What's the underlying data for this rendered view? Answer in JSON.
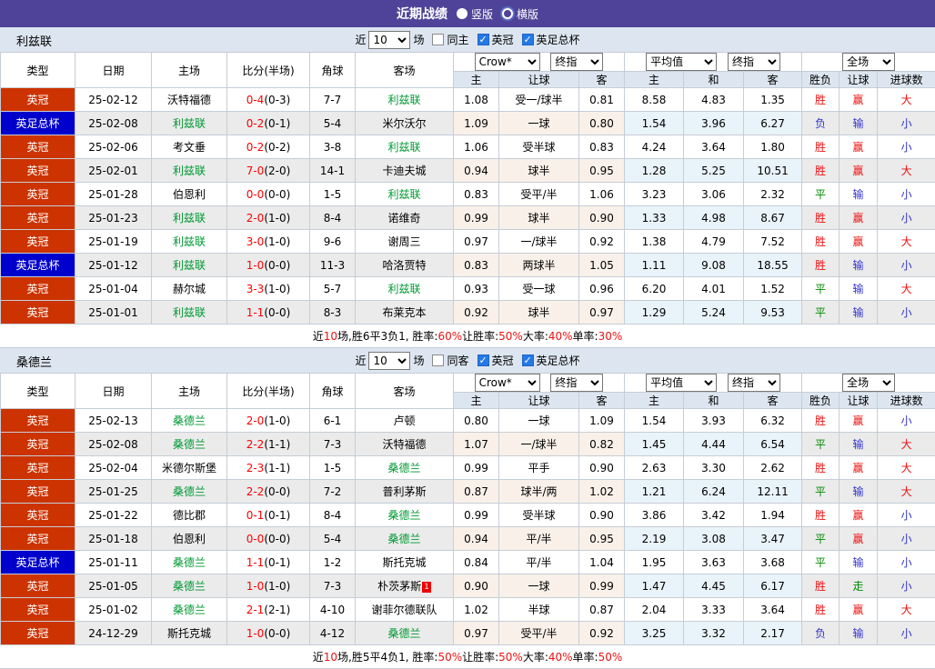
{
  "titlebar": {
    "title": "近期战绩",
    "options": [
      {
        "label": "竖版",
        "selected": true
      },
      {
        "label": "横版",
        "selected": false
      }
    ]
  },
  "header": {
    "cols": [
      "类型",
      "日期",
      "主场",
      "比分(半场)",
      "角球",
      "客场"
    ],
    "sub": [
      "主",
      "让球",
      "客",
      "主",
      "和",
      "客",
      "胜负",
      "让球",
      "进球数"
    ]
  },
  "type_colors": {
    "英冠": "#cc3300",
    "英足总杯": "#0000cc"
  },
  "colors": {
    "titlebar_bg": "#4f4399",
    "league_badge": "#cc3300",
    "cup_badge": "#0000cc",
    "focus_team_green": "#009933",
    "score_red": "#ff0000",
    "win_red": "#ee1111",
    "draw_green": "#008800",
    "lose_blue": "#3333cc",
    "header_bg": "#dde6f0",
    "handicap_col_bg": "#f9f1e9",
    "average_col_bg": "#e9f3fa",
    "alt_row_bg": "#ebebeb"
  },
  "sections": [
    {
      "team": "利兹联",
      "filter": {
        "prefix": "近",
        "count": "10",
        "suffix": "场",
        "same": "同主",
        "same_checked": false,
        "league1": "英冠",
        "league1_checked": true,
        "league2": "英足总杯",
        "league2_checked": true
      },
      "selects": {
        "odds": "Crow*",
        "odds_time": "终指",
        "avg": "平均值",
        "avg_time": "终指",
        "scope": "全场"
      },
      "rows": [
        {
          "type": "英冠",
          "date": "25-02-12",
          "home": {
            "t": "沃特福德"
          },
          "score": "0-4",
          "half": "(0-3)",
          "corners": "7-7",
          "away": {
            "t": "利兹联",
            "f": 1
          },
          "odds": [
            "1.08",
            "受一/球半",
            "0.81"
          ],
          "avg": [
            "8.58",
            "4.83",
            "1.35"
          ],
          "res": [
            [
              "胜",
              "r"
            ],
            [
              "赢",
              "r"
            ],
            [
              "大",
              "r"
            ]
          ]
        },
        {
          "type": "英足总杯",
          "date": "25-02-08",
          "home": {
            "t": "利兹联",
            "f": 1
          },
          "score": "0-2",
          "half": "(0-1)",
          "corners": "5-4",
          "away": {
            "t": "米尔沃尔"
          },
          "odds": [
            "1.09",
            "一球",
            "0.80"
          ],
          "avg": [
            "1.54",
            "3.96",
            "6.27"
          ],
          "res": [
            [
              "负",
              "b"
            ],
            [
              "输",
              "b"
            ],
            [
              "小",
              "b"
            ]
          ]
        },
        {
          "type": "英冠",
          "date": "25-02-06",
          "home": {
            "t": "考文垂"
          },
          "score": "0-2",
          "half": "(0-2)",
          "corners": "3-8",
          "away": {
            "t": "利兹联",
            "f": 1
          },
          "odds": [
            "1.06",
            "受半球",
            "0.83"
          ],
          "avg": [
            "4.24",
            "3.64",
            "1.80"
          ],
          "res": [
            [
              "胜",
              "r"
            ],
            [
              "赢",
              "r"
            ],
            [
              "小",
              "b"
            ]
          ]
        },
        {
          "type": "英冠",
          "date": "25-02-01",
          "home": {
            "t": "利兹联",
            "f": 1
          },
          "score": "7-0",
          "half": "(2-0)",
          "corners": "14-1",
          "away": {
            "t": "卡迪夫城"
          },
          "odds": [
            "0.94",
            "球半",
            "0.95"
          ],
          "avg": [
            "1.28",
            "5.25",
            "10.51"
          ],
          "res": [
            [
              "胜",
              "r"
            ],
            [
              "赢",
              "r"
            ],
            [
              "大",
              "r"
            ]
          ]
        },
        {
          "type": "英冠",
          "date": "25-01-28",
          "home": {
            "t": "伯恩利"
          },
          "score": "0-0",
          "half": "(0-0)",
          "corners": "1-5",
          "away": {
            "t": "利兹联",
            "f": 1
          },
          "odds": [
            "0.83",
            "受平/半",
            "1.06"
          ],
          "avg": [
            "3.23",
            "3.06",
            "2.32"
          ],
          "res": [
            [
              "平",
              "g"
            ],
            [
              "输",
              "b"
            ],
            [
              "小",
              "b"
            ]
          ]
        },
        {
          "type": "英冠",
          "date": "25-01-23",
          "home": {
            "t": "利兹联",
            "f": 1
          },
          "score": "2-0",
          "half": "(1-0)",
          "corners": "8-4",
          "away": {
            "t": "诺维奇"
          },
          "odds": [
            "0.99",
            "球半",
            "0.90"
          ],
          "avg": [
            "1.33",
            "4.98",
            "8.67"
          ],
          "res": [
            [
              "胜",
              "r"
            ],
            [
              "赢",
              "r"
            ],
            [
              "小",
              "b"
            ]
          ]
        },
        {
          "type": "英冠",
          "date": "25-01-19",
          "home": {
            "t": "利兹联",
            "f": 1
          },
          "score": "3-0",
          "half": "(1-0)",
          "corners": "9-6",
          "away": {
            "t": "谢周三"
          },
          "odds": [
            "0.97",
            "一/球半",
            "0.92"
          ],
          "avg": [
            "1.38",
            "4.79",
            "7.52"
          ],
          "res": [
            [
              "胜",
              "r"
            ],
            [
              "赢",
              "r"
            ],
            [
              "大",
              "r"
            ]
          ]
        },
        {
          "type": "英足总杯",
          "date": "25-01-12",
          "home": {
            "t": "利兹联",
            "f": 1
          },
          "score": "1-0",
          "half": "(0-0)",
          "corners": "11-3",
          "away": {
            "t": "哈洛贾特"
          },
          "odds": [
            "0.83",
            "两球半",
            "1.05"
          ],
          "avg": [
            "1.11",
            "9.08",
            "18.55"
          ],
          "res": [
            [
              "胜",
              "r"
            ],
            [
              "输",
              "b"
            ],
            [
              "小",
              "b"
            ]
          ]
        },
        {
          "type": "英冠",
          "date": "25-01-04",
          "home": {
            "t": "赫尔城"
          },
          "score": "3-3",
          "half": "(1-0)",
          "corners": "5-7",
          "away": {
            "t": "利兹联",
            "f": 1
          },
          "odds": [
            "0.93",
            "受一球",
            "0.96"
          ],
          "avg": [
            "6.20",
            "4.01",
            "1.52"
          ],
          "res": [
            [
              "平",
              "g"
            ],
            [
              "输",
              "b"
            ],
            [
              "大",
              "r"
            ]
          ]
        },
        {
          "type": "英冠",
          "date": "25-01-01",
          "home": {
            "t": "利兹联",
            "f": 1
          },
          "score": "1-1",
          "half": "(0-0)",
          "corners": "8-3",
          "away": {
            "t": "布莱克本"
          },
          "odds": [
            "0.92",
            "球半",
            "0.97"
          ],
          "avg": [
            "1.29",
            "5.24",
            "9.53"
          ],
          "res": [
            [
              "平",
              "g"
            ],
            [
              "输",
              "b"
            ],
            [
              "小",
              "b"
            ]
          ]
        }
      ],
      "summary": [
        {
          "t": "近"
        },
        {
          "t": "10",
          "c": "r"
        },
        {
          "t": "场,胜6平3负1, 胜率:"
        },
        {
          "t": "60%",
          "c": "r"
        },
        {
          "t": " 让胜率:"
        },
        {
          "t": "50%",
          "c": "r"
        },
        {
          "t": " 大率:"
        },
        {
          "t": "40%",
          "c": "r"
        },
        {
          "t": " 单率:"
        },
        {
          "t": "30%",
          "c": "r"
        }
      ]
    },
    {
      "team": "桑德兰",
      "filter": {
        "prefix": "近",
        "count": "10",
        "suffix": "场",
        "same": "同客",
        "same_checked": false,
        "league1": "英冠",
        "league1_checked": true,
        "league2": "英足总杯",
        "league2_checked": true
      },
      "selects": {
        "odds": "Crow*",
        "odds_time": "终指",
        "avg": "平均值",
        "avg_time": "终指",
        "scope": "全场"
      },
      "rows": [
        {
          "type": "英冠",
          "date": "25-02-13",
          "home": {
            "t": "桑德兰",
            "f": 1
          },
          "score": "2-0",
          "half": "(1-0)",
          "corners": "6-1",
          "away": {
            "t": "卢顿"
          },
          "odds": [
            "0.80",
            "一球",
            "1.09"
          ],
          "avg": [
            "1.54",
            "3.93",
            "6.32"
          ],
          "res": [
            [
              "胜",
              "r"
            ],
            [
              "赢",
              "r"
            ],
            [
              "小",
              "b"
            ]
          ]
        },
        {
          "type": "英冠",
          "date": "25-02-08",
          "home": {
            "t": "桑德兰",
            "f": 1
          },
          "score": "2-2",
          "half": "(1-1)",
          "corners": "7-3",
          "away": {
            "t": "沃特福德"
          },
          "odds": [
            "1.07",
            "一/球半",
            "0.82"
          ],
          "avg": [
            "1.45",
            "4.44",
            "6.54"
          ],
          "res": [
            [
              "平",
              "g"
            ],
            [
              "输",
              "b"
            ],
            [
              "大",
              "r"
            ]
          ]
        },
        {
          "type": "英冠",
          "date": "25-02-04",
          "home": {
            "t": "米德尔斯堡"
          },
          "score": "2-3",
          "half": "(1-1)",
          "corners": "1-5",
          "away": {
            "t": "桑德兰",
            "f": 1
          },
          "odds": [
            "0.99",
            "平手",
            "0.90"
          ],
          "avg": [
            "2.63",
            "3.30",
            "2.62"
          ],
          "res": [
            [
              "胜",
              "r"
            ],
            [
              "赢",
              "r"
            ],
            [
              "大",
              "r"
            ]
          ]
        },
        {
          "type": "英冠",
          "date": "25-01-25",
          "home": {
            "t": "桑德兰",
            "f": 1
          },
          "score": "2-2",
          "half": "(0-0)",
          "corners": "7-2",
          "away": {
            "t": "普利茅斯"
          },
          "odds": [
            "0.87",
            "球半/两",
            "1.02"
          ],
          "avg": [
            "1.21",
            "6.24",
            "12.11"
          ],
          "res": [
            [
              "平",
              "g"
            ],
            [
              "输",
              "b"
            ],
            [
              "大",
              "r"
            ]
          ]
        },
        {
          "type": "英冠",
          "date": "25-01-22",
          "home": {
            "t": "德比郡"
          },
          "score": "0-1",
          "half": "(0-1)",
          "corners": "8-4",
          "away": {
            "t": "桑德兰",
            "f": 1
          },
          "odds": [
            "0.99",
            "受半球",
            "0.90"
          ],
          "avg": [
            "3.86",
            "3.42",
            "1.94"
          ],
          "res": [
            [
              "胜",
              "r"
            ],
            [
              "赢",
              "r"
            ],
            [
              "小",
              "b"
            ]
          ]
        },
        {
          "type": "英冠",
          "date": "25-01-18",
          "home": {
            "t": "伯恩利"
          },
          "score": "0-0",
          "half": "(0-0)",
          "corners": "5-4",
          "away": {
            "t": "桑德兰",
            "f": 1
          },
          "odds": [
            "0.94",
            "平/半",
            "0.95"
          ],
          "avg": [
            "2.19",
            "3.08",
            "3.47"
          ],
          "res": [
            [
              "平",
              "g"
            ],
            [
              "赢",
              "r"
            ],
            [
              "小",
              "b"
            ]
          ]
        },
        {
          "type": "英足总杯",
          "date": "25-01-11",
          "home": {
            "t": "桑德兰",
            "f": 1
          },
          "score": "1-1",
          "half": "(0-1)",
          "corners": "1-2",
          "away": {
            "t": "斯托克城"
          },
          "odds": [
            "0.84",
            "平/半",
            "1.04"
          ],
          "avg": [
            "1.95",
            "3.63",
            "3.68"
          ],
          "res": [
            [
              "平",
              "g"
            ],
            [
              "输",
              "b"
            ],
            [
              "小",
              "b"
            ]
          ]
        },
        {
          "type": "英冠",
          "date": "25-01-05",
          "home": {
            "t": "桑德兰",
            "f": 1
          },
          "score": "1-0",
          "half": "(1-0)",
          "corners": "7-3",
          "away": {
            "t": "朴茨茅斯",
            "badge": "1"
          },
          "odds": [
            "0.90",
            "一球",
            "0.99"
          ],
          "avg": [
            "1.47",
            "4.45",
            "6.17"
          ],
          "res": [
            [
              "胜",
              "r"
            ],
            [
              "走",
              "g"
            ],
            [
              "小",
              "b"
            ]
          ]
        },
        {
          "type": "英冠",
          "date": "25-01-02",
          "home": {
            "t": "桑德兰",
            "f": 1
          },
          "score": "2-1",
          "half": "(2-1)",
          "corners": "4-10",
          "away": {
            "t": "谢菲尔德联队"
          },
          "odds": [
            "1.02",
            "半球",
            "0.87"
          ],
          "avg": [
            "2.04",
            "3.33",
            "3.64"
          ],
          "res": [
            [
              "胜",
              "r"
            ],
            [
              "赢",
              "r"
            ],
            [
              "大",
              "r"
            ]
          ]
        },
        {
          "type": "英冠",
          "date": "24-12-29",
          "home": {
            "t": "斯托克城"
          },
          "score": "1-0",
          "half": "(0-0)",
          "corners": "4-12",
          "away": {
            "t": "桑德兰",
            "f": 1
          },
          "odds": [
            "0.97",
            "受平/半",
            "0.92"
          ],
          "avg": [
            "3.25",
            "3.32",
            "2.17"
          ],
          "res": [
            [
              "负",
              "b"
            ],
            [
              "输",
              "b"
            ],
            [
              "小",
              "b"
            ]
          ]
        }
      ],
      "summary": [
        {
          "t": "近"
        },
        {
          "t": "10",
          "c": "r"
        },
        {
          "t": "场,胜5平4负1, 胜率:"
        },
        {
          "t": "50%",
          "c": "r"
        },
        {
          "t": " 让胜率:"
        },
        {
          "t": "50%",
          "c": "r"
        },
        {
          "t": " 大率:"
        },
        {
          "t": "40%",
          "c": "r"
        },
        {
          "t": " 单率:"
        },
        {
          "t": "50%",
          "c": "r"
        }
      ]
    }
  ]
}
